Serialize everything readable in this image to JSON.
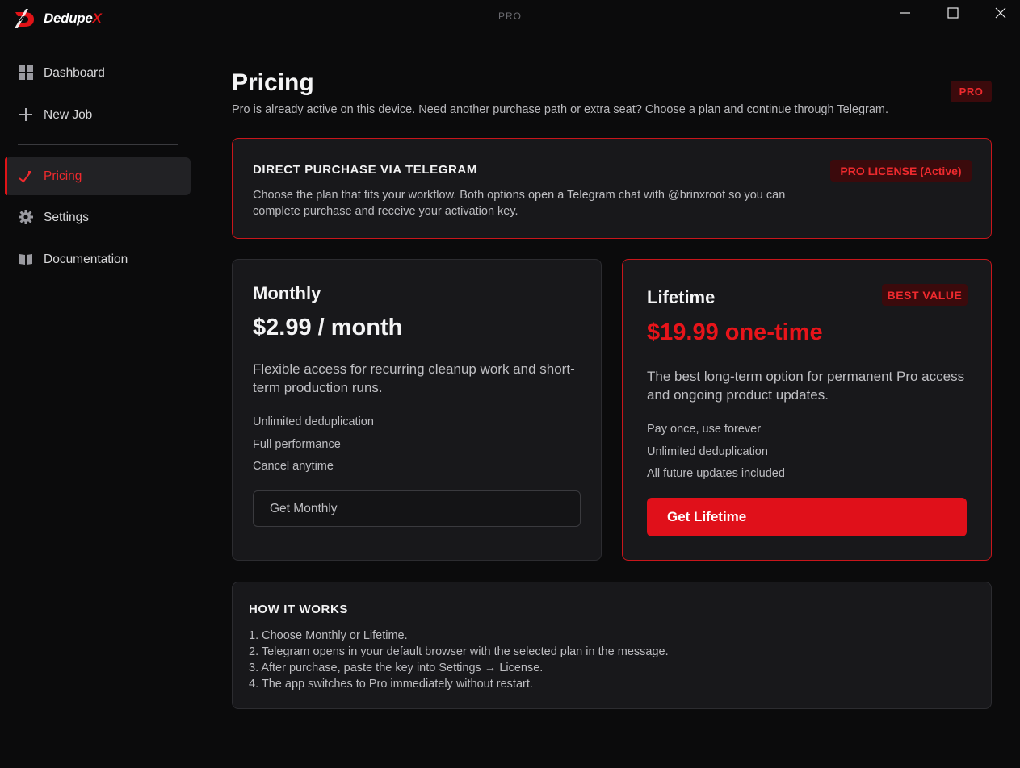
{
  "app": {
    "logo_text": "Dedupe",
    "logo_accent": "X",
    "window_title": "PRO",
    "accent_color": "#e01317"
  },
  "window_controls": [
    "minimize-icon",
    "maximize-icon",
    "close-icon"
  ],
  "sidebar": {
    "items": [
      {
        "label": "Dashboard",
        "icon": "dashboard-icon",
        "active": false
      },
      {
        "label": "New Job",
        "icon": "plus-icon",
        "active": false
      },
      {
        "label": "Pricing",
        "icon": "pricing-icon",
        "active": true
      },
      {
        "label": "Settings",
        "icon": "gear-icon",
        "active": false
      },
      {
        "label": "Documentation",
        "icon": "book-icon",
        "active": false
      }
    ]
  },
  "header": {
    "title": "Pricing",
    "subtitle": "Pro is already active on this device. Need another purchase path or extra seat? Choose a plan and continue through Telegram.",
    "badge": "PRO"
  },
  "direct": {
    "title": "DIRECT PURCHASE VIA TELEGRAM",
    "description": "Choose the plan that fits your workflow. Both options open a Telegram chat with @brinxroot so you can complete purchase and receive your activation key.",
    "license_badge": "PRO LICENSE (Active)"
  },
  "plans": {
    "monthly": {
      "name": "Monthly",
      "price": "$2.99 / month",
      "description": "Flexible access for recurring cleanup work and short-term production runs.",
      "features": [
        "Unlimited deduplication",
        "Full performance",
        "Cancel anytime"
      ],
      "button": "Get Monthly"
    },
    "lifetime": {
      "name": "Lifetime",
      "badge": "BEST VALUE",
      "price": "$19.99 one-time",
      "description": "The best long-term option for permanent Pro access and ongoing product updates.",
      "features": [
        "Pay once, use forever",
        "Unlimited deduplication",
        "All future updates included"
      ],
      "button": "Get Lifetime"
    }
  },
  "how_it_works": {
    "title": "HOW IT WORKS",
    "steps": [
      "1. Choose Monthly or Lifetime.",
      "2. Telegram opens in your default browser with the selected plan in the message.",
      "3. After purchase, paste the key into Settings → License.",
      "4. The app switches to Pro immediately without restart."
    ]
  }
}
